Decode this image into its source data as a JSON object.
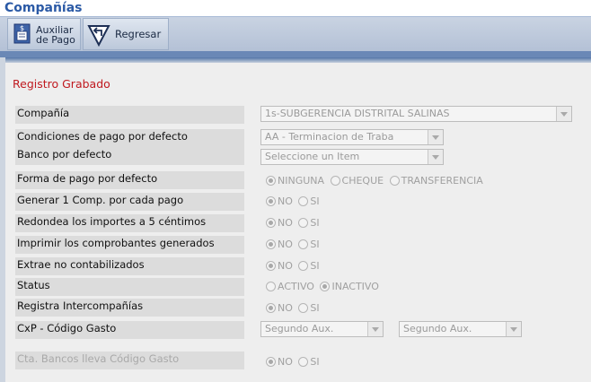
{
  "title": "Compañías",
  "toolbar": {
    "auxiliar_line1": "Auxiliar",
    "auxiliar_line2": "de Pago",
    "regresar": "Regresar"
  },
  "status_message": "Registro Grabado",
  "rows": {
    "compania": {
      "label": "Compañía",
      "value": "1s-SUBGERENCIA DISTRITAL SALINAS"
    },
    "condiciones": {
      "label": "Condiciones de pago por defecto",
      "value": "AA - Terminacion de Traba"
    },
    "banco": {
      "label": "Banco por defecto",
      "value": "Seleccione un Item"
    },
    "forma_pago": {
      "label": "Forma de pago por defecto",
      "options": [
        "NINGUNA",
        "CHEQUE",
        "TRANSFERENCIA"
      ],
      "selected": "NINGUNA"
    },
    "generar": {
      "label": "Generar 1 Comp. por cada pago",
      "options": [
        "NO",
        "SI"
      ],
      "selected": "NO"
    },
    "redondea": {
      "label": "Redondea los importes a 5 céntimos",
      "options": [
        "NO",
        "SI"
      ],
      "selected": "NO"
    },
    "imprimir": {
      "label": "Imprimir los comprobantes generados",
      "options": [
        "NO",
        "SI"
      ],
      "selected": "NO"
    },
    "extrae": {
      "label": "Extrae no contabilizados",
      "options": [
        "NO",
        "SI"
      ],
      "selected": "NO"
    },
    "status": {
      "label": "Status",
      "options": [
        "ACTIVO",
        "INACTIVO"
      ],
      "selected": "INACTIVO"
    },
    "registra": {
      "label": "Registra Intercompañías",
      "options": [
        "NO",
        "SI"
      ],
      "selected": "NO"
    },
    "cxp": {
      "label": "CxP - Código Gasto",
      "value1": "Segundo Aux.",
      "value2": "Segundo Aux."
    },
    "cta_bancos": {
      "label": "Cta. Bancos lleva Código Gasto",
      "options": [
        "NO",
        "SI"
      ],
      "selected": "NO"
    }
  }
}
